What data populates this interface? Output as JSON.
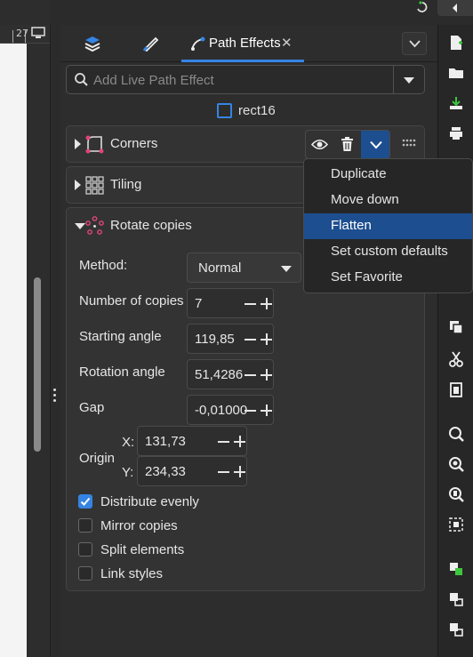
{
  "canvas": {
    "ruler_value": "27"
  },
  "tabs": [
    {
      "name": "layers-tab",
      "label": ""
    },
    {
      "name": "fill-stroke-tab",
      "label": ""
    },
    {
      "name": "path-effects-tab",
      "label": "Path Effects",
      "close": "✕"
    }
  ],
  "search": {
    "placeholder": "Add Live Path Effect"
  },
  "object": {
    "name": "rect16"
  },
  "effects": [
    {
      "name": "Corners",
      "expanded": false
    },
    {
      "name": "Tiling",
      "expanded": false
    },
    {
      "name": "Rotate copies",
      "expanded": true
    }
  ],
  "rotate": {
    "method_label": "Method:",
    "method_value": "Normal",
    "copies_label": "Number of copies",
    "copies_value": "7",
    "start_label": "Starting angle",
    "start_value": "119,85",
    "rotation_label": "Rotation angle",
    "rotation_value": "51,4286",
    "gap_label": "Gap",
    "gap_value": "-0,01000",
    "origin_label": "Origin",
    "x_label": "X:",
    "x_value": "131,73",
    "y_label": "Y:",
    "y_value": "234,33",
    "checkboxes": [
      {
        "label": "Distribute evenly",
        "checked": true
      },
      {
        "label": "Mirror copies",
        "checked": false
      },
      {
        "label": "Split elements",
        "checked": false
      },
      {
        "label": "Link styles",
        "checked": false
      }
    ]
  },
  "context_menu": {
    "items": [
      "Duplicate",
      "Move down",
      "Flatten",
      "Set custom defaults",
      "Set Favorite"
    ],
    "selected": "Flatten"
  },
  "colors": {
    "accent": "#3584e4",
    "selection": "#1d4e8f",
    "corners_icon": "#e0457b"
  }
}
